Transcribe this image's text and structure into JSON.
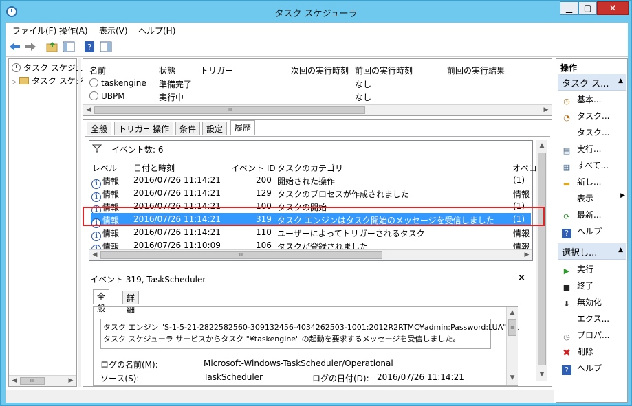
{
  "window": {
    "title": "タスク スケジューラ",
    "min": "▁",
    "max": "▢",
    "close": "✕"
  },
  "menu": [
    "ファイル(F)",
    "操作(A)",
    "表示(V)",
    "ヘルプ(H)"
  ],
  "tree": {
    "root": "タスク スケジュー",
    "child": "タスク スケジ",
    "expander": "▷"
  },
  "tasklist": {
    "headers": [
      "名前",
      "状態",
      "トリガー",
      "次回の実行時刻",
      "前回の実行時刻",
      "前回の実行結果"
    ],
    "rows": [
      {
        "name": "taskengine",
        "status": "準備完了",
        "last": "なし"
      },
      {
        "name": "UBPM",
        "status": "実行中",
        "last": "なし"
      }
    ]
  },
  "tabs": [
    "全般",
    "トリガー",
    "操作",
    "条件",
    "設定",
    "履歴"
  ],
  "history": {
    "filter_label": "イベント数: 6",
    "headers": [
      "レベル",
      "日付と時刻",
      "イベント ID",
      "タスクのカテゴリ",
      "オペコー"
    ],
    "rows": [
      {
        "level": "情報",
        "date": "2016/07/26 11:14:21",
        "id": "200",
        "cat": "開始された操作",
        "op": "(1)"
      },
      {
        "level": "情報",
        "date": "2016/07/26 11:14:21",
        "id": "129",
        "cat": "タスクのプロセスが作成されました",
        "op": "情報"
      },
      {
        "level": "情報",
        "date": "2016/07/26 11:14:21",
        "id": "100",
        "cat": "タスクの開始",
        "op": "(1)"
      },
      {
        "level": "情報",
        "date": "2016/07/26 11:14:21",
        "id": "319",
        "cat": "タスク エンジンはタスク開始のメッセージを受信しました",
        "op": "(1)"
      },
      {
        "level": "情報",
        "date": "2016/07/26 11:14:21",
        "id": "110",
        "cat": "ユーザーによってトリガーされるタスク",
        "op": "情報"
      },
      {
        "level": "情報",
        "date": "2016/07/26 11:10:09",
        "id": "106",
        "cat": "タスクが登録されました",
        "op": "情報"
      }
    ]
  },
  "detail": {
    "header": "イベント 319, TaskScheduler",
    "close": "×",
    "tabs": [
      "全般",
      "詳細"
    ],
    "message_line1": "タスク エンジン \"S-1-5-21-2822582560-309132456-4034262503-1001:2012R2RTMC¥admin:Password:LUA\" は、",
    "message_line2": "タスク スケジューラ サービスからタスク \"¥taskengine\" の起動を要求するメッセージを受信しました。",
    "log_label": "ログの名前(M):",
    "log_value": "Microsoft-Windows-TaskScheduler/Operational",
    "source_label": "ソース(S):",
    "source_value": "TaskScheduler",
    "date_label": "ログの日付(D):",
    "date_value": "2016/07/26 11:14:21"
  },
  "actions": {
    "title": "操作",
    "group1": "タスク ス...",
    "items1": [
      "基本...",
      "タスク...",
      "タスク...",
      "実行...",
      "すべて...",
      "新し...",
      "表示",
      "最新...",
      "ヘルプ"
    ],
    "group2": "選択し...",
    "items2": [
      "実行",
      "終了",
      "無効化",
      "エクス...",
      "プロパ...",
      "削除",
      "ヘルプ"
    ]
  }
}
